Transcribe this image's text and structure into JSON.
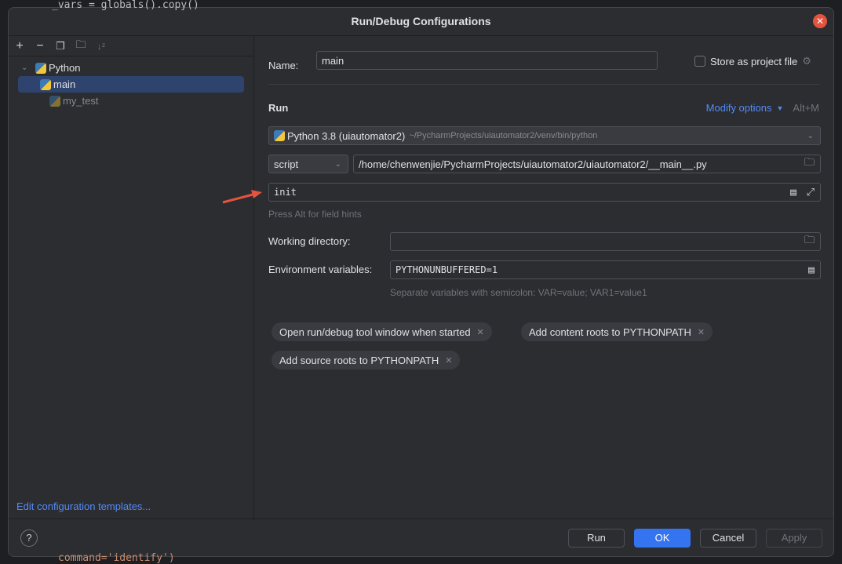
{
  "background": {
    "code_top": "_vars = globals().copy()",
    "code_bottom": "command='identify')"
  },
  "dialog": {
    "title": "Run/Debug Configurations"
  },
  "toolbar": {
    "icons": [
      "add-icon",
      "remove-icon",
      "copy-icon",
      "new-folder-icon",
      "sort-icon"
    ]
  },
  "tree": {
    "group": "Python",
    "items": [
      {
        "label": "main",
        "selected": true
      },
      {
        "label": "my_test",
        "selected": false
      }
    ]
  },
  "left_footer": {
    "templates_link": "Edit configuration templates..."
  },
  "form": {
    "name_label": "Name:",
    "name_value": "main",
    "store_label": "Store as project file",
    "store_checked": false,
    "run_label": "Run",
    "modify_options": "Modify options",
    "modify_shortcut": "Alt+M",
    "interpreter": "Python 3.8 (uiautomator2)",
    "interpreter_path": "~/PycharmProjects/uiautomator2/venv/bin/python",
    "target_type": "script",
    "script_path": "/home/chenwenjie/PycharmProjects/uiautomator2/uiautomator2/__main__.py",
    "parameters": "init",
    "field_hint": "Press Alt for field hints",
    "workdir_label": "Working directory:",
    "workdir_value": "",
    "env_label": "Environment variables:",
    "env_value": "PYTHONUNBUFFERED=1",
    "env_hint": "Separate variables with semicolon: VAR=value; VAR1=value1",
    "chips": [
      "Open run/debug tool window when started",
      "Add content roots to PYTHONPATH",
      "Add source roots to PYTHONPATH"
    ]
  },
  "buttons": {
    "run": "Run",
    "ok": "OK",
    "cancel": "Cancel",
    "apply": "Apply",
    "help": "?"
  },
  "colors": {
    "accent": "#3574f0",
    "link": "#548af7",
    "selection": "#2e436e",
    "close": "#e5533f",
    "arrow": "#e5533f"
  }
}
